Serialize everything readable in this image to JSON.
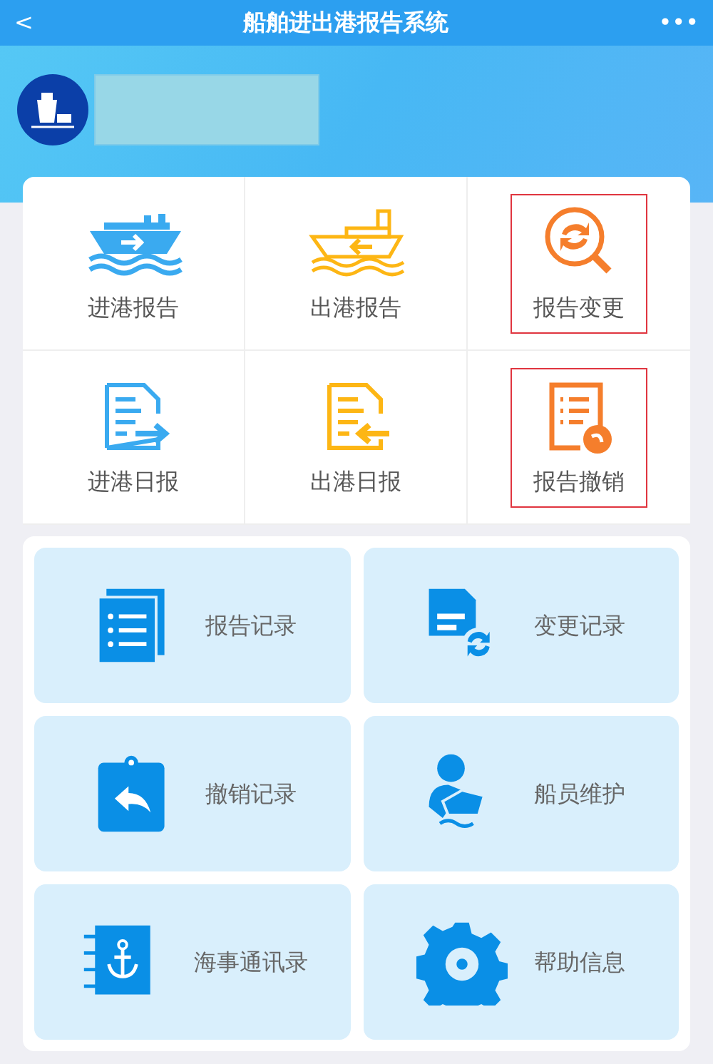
{
  "header": {
    "back": "<",
    "title": "船舶进出港报告系统",
    "more": "•••"
  },
  "profile": {
    "kind": "redacted"
  },
  "report_grid": [
    {
      "label": "进港报告",
      "kind": "ship-in",
      "color": "#3aaaf0",
      "highlighted": false
    },
    {
      "label": "出港报告",
      "kind": "ship-out",
      "color": "#fdb614",
      "highlighted": false
    },
    {
      "label": "报告变更",
      "kind": "change-search",
      "color": "#f57e2c",
      "highlighted": true
    },
    {
      "label": "进港日报",
      "kind": "doc-in",
      "color": "#3aaaf0",
      "highlighted": false
    },
    {
      "label": "出港日报",
      "kind": "doc-out",
      "color": "#fdb614",
      "highlighted": false
    },
    {
      "label": "报告撤销",
      "kind": "doc-undo",
      "color": "#f57e2c",
      "highlighted": true
    }
  ],
  "records": [
    {
      "label": "报告记录",
      "kind": "list"
    },
    {
      "label": "变更记录",
      "kind": "doc-sync"
    },
    {
      "label": "撤销记录",
      "kind": "clipboard-undo"
    },
    {
      "label": "船员维护",
      "kind": "crew"
    },
    {
      "label": "海事通讯录",
      "kind": "anchor-book"
    },
    {
      "label": "帮助信息",
      "kind": "gear"
    }
  ]
}
